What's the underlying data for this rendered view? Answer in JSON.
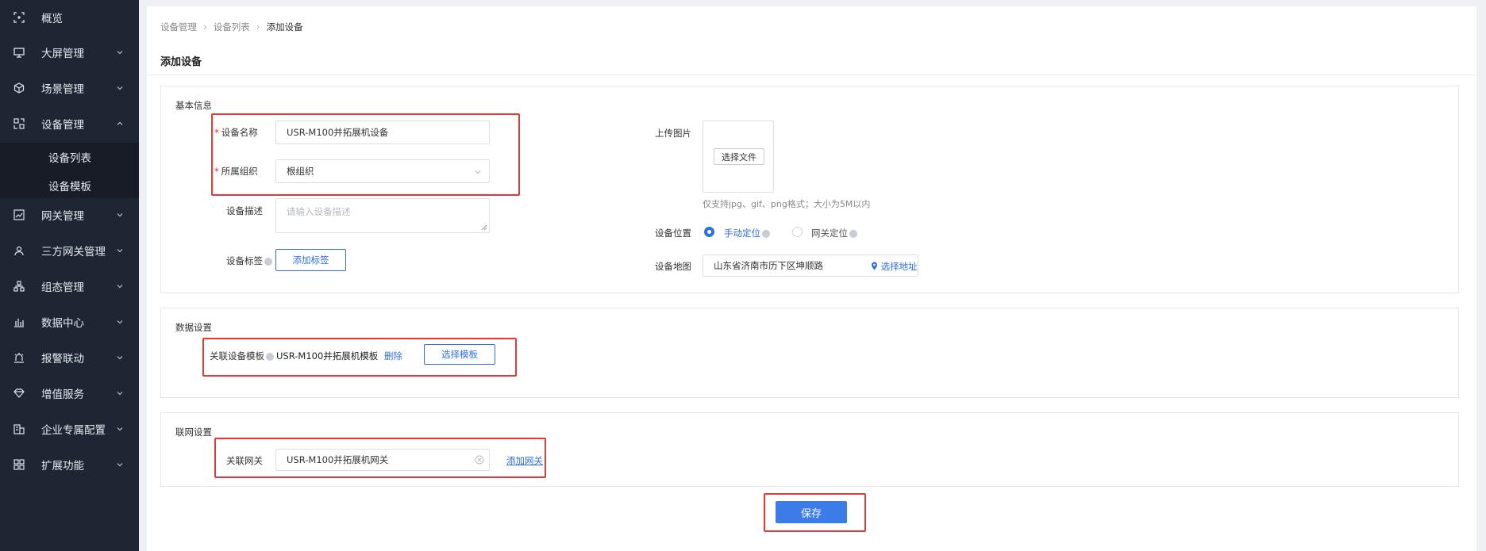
{
  "sidebar": {
    "items": [
      {
        "label": "概览",
        "icon": "overview-icon"
      },
      {
        "label": "大屏管理",
        "icon": "monitor-icon"
      },
      {
        "label": "场景管理",
        "icon": "cube-icon"
      },
      {
        "label": "设备管理",
        "icon": "device-grid-icon"
      },
      {
        "label": "网关管理",
        "icon": "gateway-chart-icon"
      },
      {
        "label": "三方网关管理",
        "icon": "third-party-icon"
      },
      {
        "label": "组态管理",
        "icon": "hierarchy-icon"
      },
      {
        "label": "数据中心",
        "icon": "bar-chart-icon"
      },
      {
        "label": "报警联动",
        "icon": "alarm-icon"
      },
      {
        "label": "增值服务",
        "icon": "diamond-icon"
      },
      {
        "label": "企业专属配置",
        "icon": "enterprise-icon"
      },
      {
        "label": "扩展功能",
        "icon": "apps-icon"
      }
    ],
    "submenu": [
      "设备列表",
      "设备模板"
    ]
  },
  "breadcrumb": [
    "设备管理",
    "设备列表",
    "添加设备"
  ],
  "page_title": "添加设备",
  "basic": {
    "section_title": "基本信息",
    "name_label": "设备名称",
    "name_value": "USR-M100并拓展机设备",
    "org_label": "所属组织",
    "org_value": "根组织",
    "desc_label": "设备描述",
    "desc_placeholder": "请输入设备描述",
    "tag_label": "设备标签",
    "tag_button": "添加标签",
    "upload_label": "上传图片",
    "upload_button": "选择文件",
    "upload_hint": "仅支持jpg、gif、png格式；大小为5M以内",
    "location_label": "设备位置",
    "location_manual": "手动定位",
    "location_gateway": "网关定位",
    "map_label": "设备地图",
    "map_value": "山东省济南市历下区坤顺路",
    "map_link": "选择地址"
  },
  "data_settings": {
    "section_title": "数据设置",
    "template_label": "关联设备模板",
    "template_value": "USR-M100并拓展机模板",
    "delete_link": "删除",
    "select_button": "选择模板"
  },
  "network": {
    "section_title": "联网设置",
    "gateway_label": "关联网关",
    "gateway_value": "USR-M100并拓展机网关",
    "add_link": "添加网关"
  },
  "save_button": "保存",
  "colors": {
    "sidebar_bg": "#1f2633",
    "accent": "#3b7ce8",
    "highlight": "#e53935",
    "required": "#f5222d"
  }
}
